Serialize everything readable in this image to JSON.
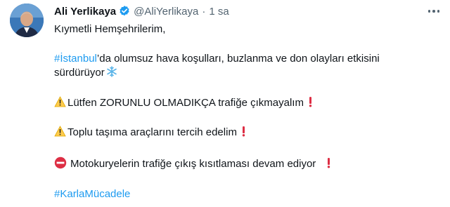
{
  "tweet": {
    "author_name": "Ali Yerlikaya",
    "handle": "@AliYerlikaya",
    "separator": "·",
    "time": "1 sa",
    "greeting": "Kıymetli Hemşehrilerim,",
    "line1": {
      "hashtag": "#İstanbul",
      "text": "’da olumsuz hava koşulları, buzlanma ve don olayları etkisini"
    },
    "line1b": "sürdürüyor",
    "warning1": "Lütfen ZORUNLU OLMADIKÇA trafiğe çıkmayalım",
    "warning2": "Toplu taşıma araçlarını tercih edelim",
    "notice": "Motokuryelerin trafiğe çıkış kısıtlaması devam ediyor",
    "hashtag_closing": "#KarlaMücadele"
  },
  "colors": {
    "link": "#1d9bf0",
    "text": "#0f1419",
    "muted": "#536471",
    "verified": "#1d9bf0"
  },
  "icons": [
    "verified-badge-icon",
    "more-icon",
    "snowflake-icon",
    "warning-icon",
    "exclamation-icon",
    "no-entry-icon"
  ]
}
